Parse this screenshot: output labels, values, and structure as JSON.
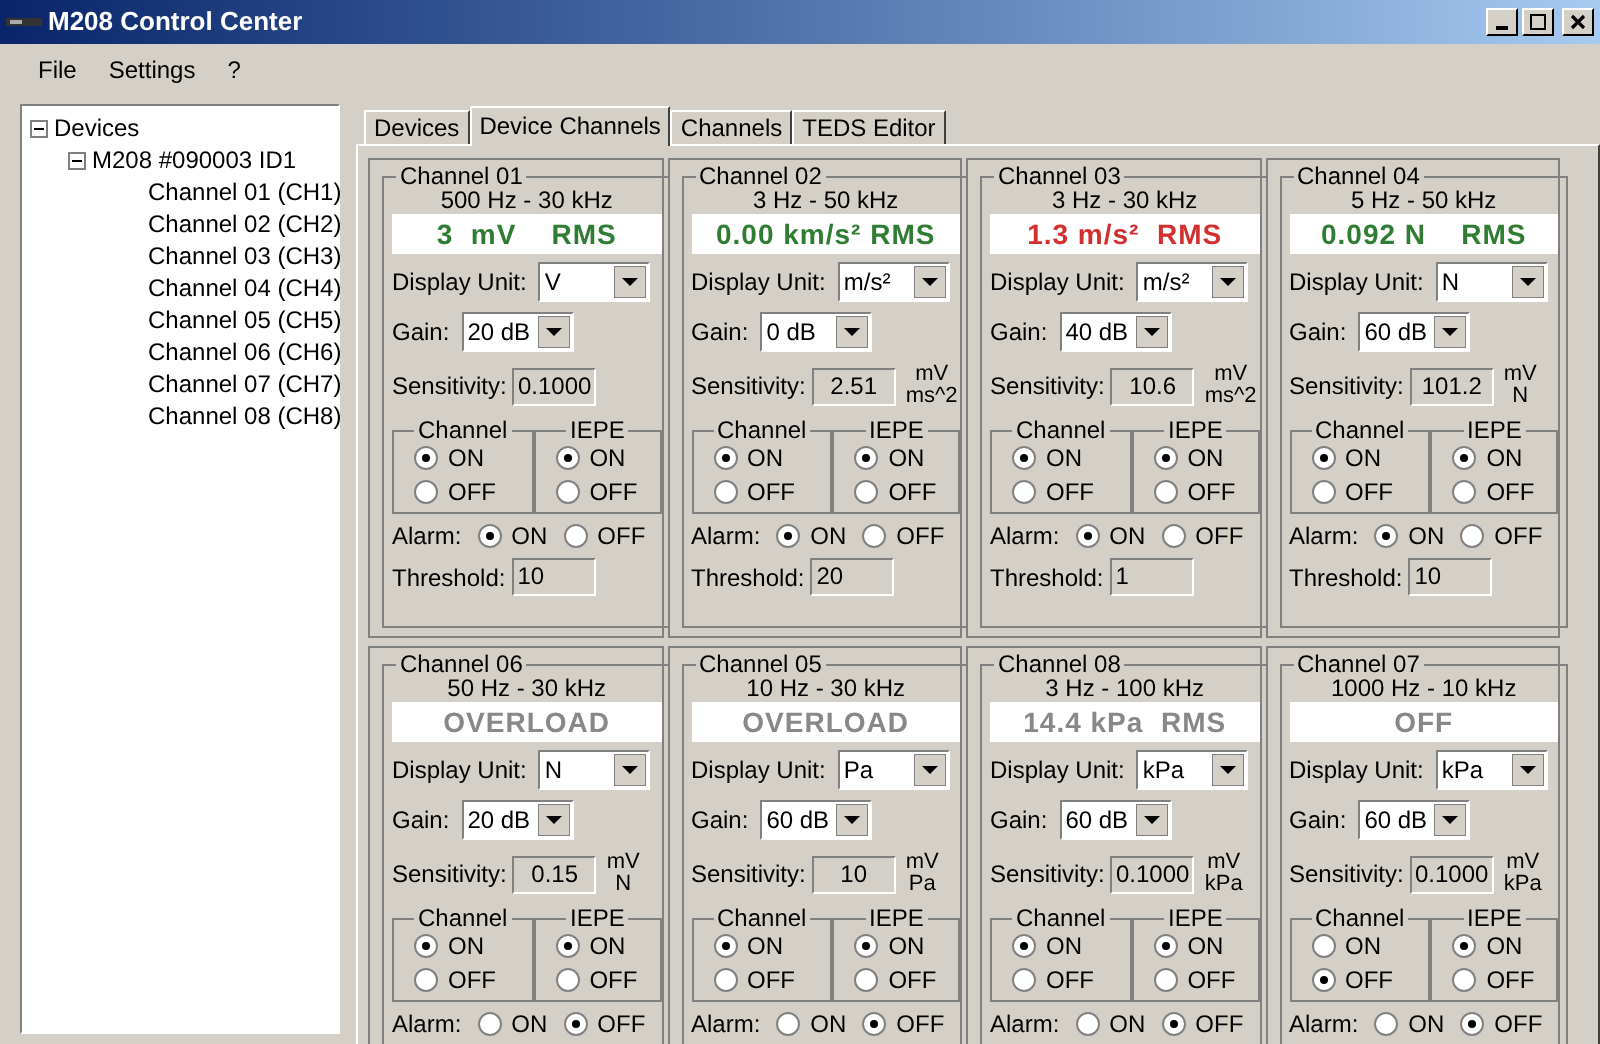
{
  "window": {
    "title": "M208 Control Center"
  },
  "menu": [
    "File",
    "Settings",
    "?"
  ],
  "tree": [
    {
      "label": "Devices",
      "expanded": true,
      "children": [
        {
          "label": "M208 #090003 ID1",
          "expanded": true,
          "children": [
            {
              "label": "Channel 01 (CH1)"
            },
            {
              "label": "Channel 02 (CH2)"
            },
            {
              "label": "Channel 03 (CH3)"
            },
            {
              "label": "Channel 04 (CH4)"
            },
            {
              "label": "Channel 05 (CH5)"
            },
            {
              "label": "Channel 06 (CH6)"
            },
            {
              "label": "Channel 07 (CH7)"
            },
            {
              "label": "Channel 08 (CH8)"
            }
          ]
        }
      ]
    }
  ],
  "tabs": [
    {
      "label": "Devices",
      "selected": false
    },
    {
      "label": "Device Channels",
      "selected": true
    },
    {
      "label": "Channels",
      "selected": false
    },
    {
      "label": "TEDS Editor",
      "selected": false
    }
  ],
  "channels": [
    {
      "title": "Channel 01",
      "range": "500 Hz - 30 kHz",
      "readout": {
        "text": "3  mV    RMS",
        "color": "#2e7d32"
      },
      "unit_label": "Display Unit:",
      "unit": "V",
      "gain_label": "Gain:",
      "gain": "20 dB",
      "sens_label": "Sensitivity:",
      "sensitivity": "0.1000",
      "channel_title": "Channel",
      "channel": [
        {
          "label": "ON",
          "selected": true
        },
        {
          "label": "OFF",
          "selected": false
        }
      ],
      "iepe_title": "IEPE",
      "iepe": [
        {
          "label": "ON",
          "selected": true
        },
        {
          "label": "OFF",
          "selected": false
        }
      ],
      "alarm_label": "Alarm:",
      "alarm": [
        {
          "label": "ON",
          "selected": true
        },
        {
          "label": "OFF",
          "selected": false
        }
      ],
      "threshold_label": "Threshold:",
      "threshold": "10"
    },
    {
      "title": "Channel 02",
      "range": "3 Hz - 50 kHz",
      "readout": {
        "text": "0.00 km/s² RMS",
        "color": "#2e7d32"
      },
      "unit_label": "Display Unit:",
      "unit": "m/s²",
      "gain_label": "Gain:",
      "gain": "0 dB",
      "sens_label": "Sensitivity:",
      "sensitivity": "2.51",
      "sens_units": [
        "mV",
        "ms^2"
      ],
      "channel_title": "Channel",
      "channel": [
        {
          "label": "ON",
          "selected": true
        },
        {
          "label": "OFF",
          "selected": false
        }
      ],
      "iepe_title": "IEPE",
      "iepe": [
        {
          "label": "ON",
          "selected": true
        },
        {
          "label": "OFF",
          "selected": false
        }
      ],
      "alarm_label": "Alarm:",
      "alarm": [
        {
          "label": "ON",
          "selected": true
        },
        {
          "label": "OFF",
          "selected": false
        }
      ],
      "threshold_label": "Threshold:",
      "threshold": "20"
    },
    {
      "title": "Channel 03",
      "range": "3 Hz - 30 kHz",
      "readout": {
        "text": "1.3 m/s²  RMS",
        "color": "#d32f2f"
      },
      "unit_label": "Display Unit:",
      "unit": "m/s²",
      "gain_label": "Gain:",
      "gain": "40 dB",
      "sens_label": "Sensitivity:",
      "sensitivity": "10.6",
      "sens_units": [
        "mV",
        "ms^2"
      ],
      "channel_title": "Channel",
      "channel": [
        {
          "label": "ON",
          "selected": true
        },
        {
          "label": "OFF",
          "selected": false
        }
      ],
      "iepe_title": "IEPE",
      "iepe": [
        {
          "label": "ON",
          "selected": true
        },
        {
          "label": "OFF",
          "selected": false
        }
      ],
      "alarm_label": "Alarm:",
      "alarm": [
        {
          "label": "ON",
          "selected": true
        },
        {
          "label": "OFF",
          "selected": false
        }
      ],
      "threshold_label": "Threshold:",
      "threshold": "1"
    },
    {
      "title": "Channel 04",
      "range": "5 Hz - 50 kHz",
      "readout": {
        "text": "0.092 N    RMS",
        "color": "#2e7d32"
      },
      "unit_label": "Display Unit:",
      "unit": "N",
      "gain_label": "Gain:",
      "gain": "60 dB",
      "sens_label": "Sensitivity:",
      "sensitivity": "101.2",
      "sens_units": [
        "mV",
        "N"
      ],
      "channel_title": "Channel",
      "channel": [
        {
          "label": "ON",
          "selected": true
        },
        {
          "label": "OFF",
          "selected": false
        }
      ],
      "iepe_title": "IEPE",
      "iepe": [
        {
          "label": "ON",
          "selected": true
        },
        {
          "label": "OFF",
          "selected": false
        }
      ],
      "alarm_label": "Alarm:",
      "alarm": [
        {
          "label": "ON",
          "selected": true
        },
        {
          "label": "OFF",
          "selected": false
        }
      ],
      "threshold_label": "Threshold:",
      "threshold": "10"
    },
    {
      "title": "Channel 06",
      "range": "50 Hz - 30 kHz",
      "readout": {
        "text": "OVERLOAD",
        "color": "#888888"
      },
      "unit_label": "Display Unit:",
      "unit": "N",
      "gain_label": "Gain:",
      "gain": "20 dB",
      "sens_label": "Sensitivity:",
      "sensitivity": "0.15",
      "sens_units": [
        "mV",
        "N"
      ],
      "channel_title": "Channel",
      "channel": [
        {
          "label": "ON",
          "selected": true
        },
        {
          "label": "OFF",
          "selected": false
        }
      ],
      "iepe_title": "IEPE",
      "iepe": [
        {
          "label": "ON",
          "selected": true
        },
        {
          "label": "OFF",
          "selected": false
        }
      ],
      "alarm_label": "Alarm:",
      "alarm": [
        {
          "label": "ON",
          "selected": false
        },
        {
          "label": "OFF",
          "selected": true
        }
      ]
    },
    {
      "title": "Channel 05",
      "range": "10 Hz - 30 kHz",
      "readout": {
        "text": "OVERLOAD",
        "color": "#888888"
      },
      "unit_label": "Display Unit:",
      "unit": "Pa",
      "gain_label": "Gain:",
      "gain": "60 dB",
      "sens_label": "Sensitivity:",
      "sensitivity": "10",
      "sens_units": [
        "mV",
        "Pa"
      ],
      "channel_title": "Channel",
      "channel": [
        {
          "label": "ON",
          "selected": true
        },
        {
          "label": "OFF",
          "selected": false
        }
      ],
      "iepe_title": "IEPE",
      "iepe": [
        {
          "label": "ON",
          "selected": true
        },
        {
          "label": "OFF",
          "selected": false
        }
      ],
      "alarm_label": "Alarm:",
      "alarm": [
        {
          "label": "ON",
          "selected": false
        },
        {
          "label": "OFF",
          "selected": true
        }
      ]
    },
    {
      "title": "Channel 08",
      "range": "3 Hz - 100 kHz",
      "readout": {
        "text": "14.4 kPa  RMS",
        "color": "#888888"
      },
      "unit_label": "Display Unit:",
      "unit": "kPa",
      "gain_label": "Gain:",
      "gain": "60 dB",
      "sens_label": "Sensitivity:",
      "sensitivity": "0.1000",
      "sens_units": [
        "mV",
        "kPa"
      ],
      "channel_title": "Channel",
      "channel": [
        {
          "label": "ON",
          "selected": true
        },
        {
          "label": "OFF",
          "selected": false
        }
      ],
      "iepe_title": "IEPE",
      "iepe": [
        {
          "label": "ON",
          "selected": true
        },
        {
          "label": "OFF",
          "selected": false
        }
      ],
      "alarm_label": "Alarm:",
      "alarm": [
        {
          "label": "ON",
          "selected": false
        },
        {
          "label": "OFF",
          "selected": true
        }
      ]
    },
    {
      "title": "Channel 07",
      "range": "1000 Hz - 10 kHz",
      "readout": {
        "text": "OFF",
        "color": "#888888"
      },
      "unit_label": "Display Unit:",
      "unit": "kPa",
      "gain_label": "Gain:",
      "gain": "60 dB",
      "sens_label": "Sensitivity:",
      "sensitivity": "0.1000",
      "sens_units": [
        "mV",
        "kPa"
      ],
      "channel_title": "Channel",
      "channel": [
        {
          "label": "ON",
          "selected": false
        },
        {
          "label": "OFF",
          "selected": true
        }
      ],
      "iepe_title": "IEPE",
      "iepe": [
        {
          "label": "ON",
          "selected": true
        },
        {
          "label": "OFF",
          "selected": false
        }
      ],
      "alarm_label": "Alarm:",
      "alarm": [
        {
          "label": "ON",
          "selected": false
        },
        {
          "label": "OFF",
          "selected": true
        }
      ]
    }
  ]
}
